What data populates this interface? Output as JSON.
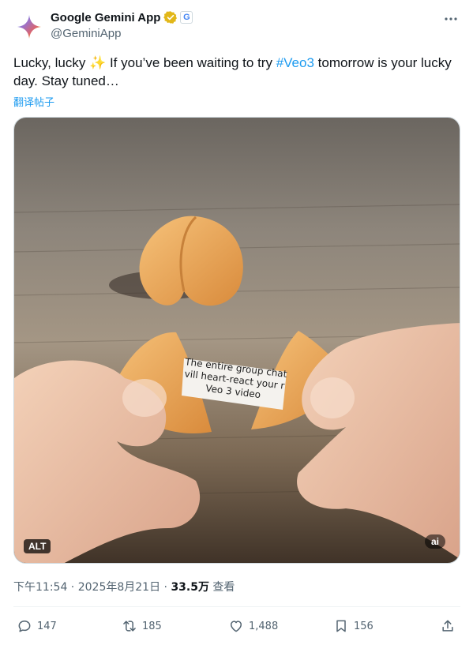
{
  "author": {
    "display_name": "Google Gemini App",
    "handle": "@GeminiApp",
    "affiliate_badge": "G"
  },
  "tweet": {
    "text_before": "Lucky, lucky ",
    "sparkle": "✨",
    "text_mid": " If you’ve been waiting to try ",
    "hashtag": "#Veo3",
    "text_after": " tomorrow is your lucky day. Stay tuned…",
    "translate_label": "翻译帖子"
  },
  "media": {
    "alt_badge": "ALT",
    "ai_badge": "ai",
    "fortune_line1": "The entire group chat",
    "fortune_line2": "vill heart-react your r",
    "fortune_line3": "Veo 3 video"
  },
  "meta": {
    "time": "下午11:54",
    "date": "2025年8月21日",
    "separator": " · ",
    "views_count": "33.5万",
    "views_label": " 查看"
  },
  "actions": {
    "replies": "147",
    "reposts": "185",
    "likes": "1,488",
    "bookmarks": "156"
  },
  "colors": {
    "accent": "#1d9bf0",
    "secondary_text": "#536471",
    "verified_gold": "#e2b719"
  },
  "icons": [
    "gemini-logo-icon",
    "verified-badge-icon",
    "more-icon",
    "reply-icon",
    "repost-icon",
    "like-icon",
    "bookmark-icon",
    "share-icon"
  ]
}
